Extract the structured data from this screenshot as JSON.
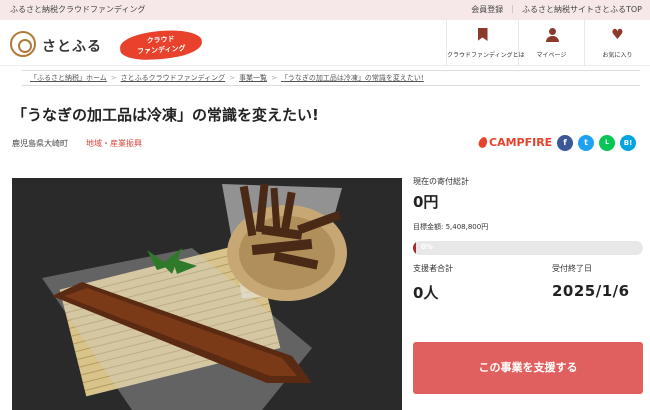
{
  "topbar": {
    "tagline": "ふるさと納税クラウドファンディング",
    "links": [
      "会員登録",
      "ふるさと納税サイトさとふるTOP"
    ]
  },
  "header": {
    "logo_text": "さとふる",
    "badge_line1": "クラウド",
    "badge_line2": "ファンディング",
    "nav": [
      {
        "label": "クラウドファンディングとは",
        "icon": "bookmark-icon"
      },
      {
        "label": "マイページ",
        "icon": "user-icon"
      },
      {
        "label": "お気に入り",
        "icon": "heart-icon"
      }
    ]
  },
  "breadcrumb": [
    "「ふるさと納税」ホーム",
    "さとふるクラウドファンディング",
    "事業一覧",
    "「うなぎの加工品は冷凍」の常識を変えたい!"
  ],
  "project": {
    "title": "「うなぎの加工品は冷凍」の常識を変えたい!",
    "location": "鹿児島県大崎町",
    "category": "地域・産業振興",
    "platform": "CAMPFIRE"
  },
  "share": [
    {
      "name": "facebook",
      "glyph": "f",
      "color": "#3b5998"
    },
    {
      "name": "twitter",
      "glyph": "t",
      "color": "#1da1f2"
    },
    {
      "name": "line",
      "glyph": "L",
      "color": "#06c755"
    },
    {
      "name": "hatena",
      "glyph": "B!",
      "color": "#00a4de"
    }
  ],
  "stats": {
    "current_label": "現在の寄付総計",
    "current_value": "0円",
    "target_label": "目標金額: 5,408,800円",
    "progress_percent": 0,
    "progress_text": "0%",
    "supporters_label": "支援者合計",
    "supporters_value": "0人",
    "deadline_label": "受付終了日",
    "deadline_value": "2025/1/6"
  },
  "cta_label": "この事業を支援する",
  "colors": {
    "accent": "#e0605f",
    "brand": "#e8412c",
    "progress": "#a72e2e"
  }
}
